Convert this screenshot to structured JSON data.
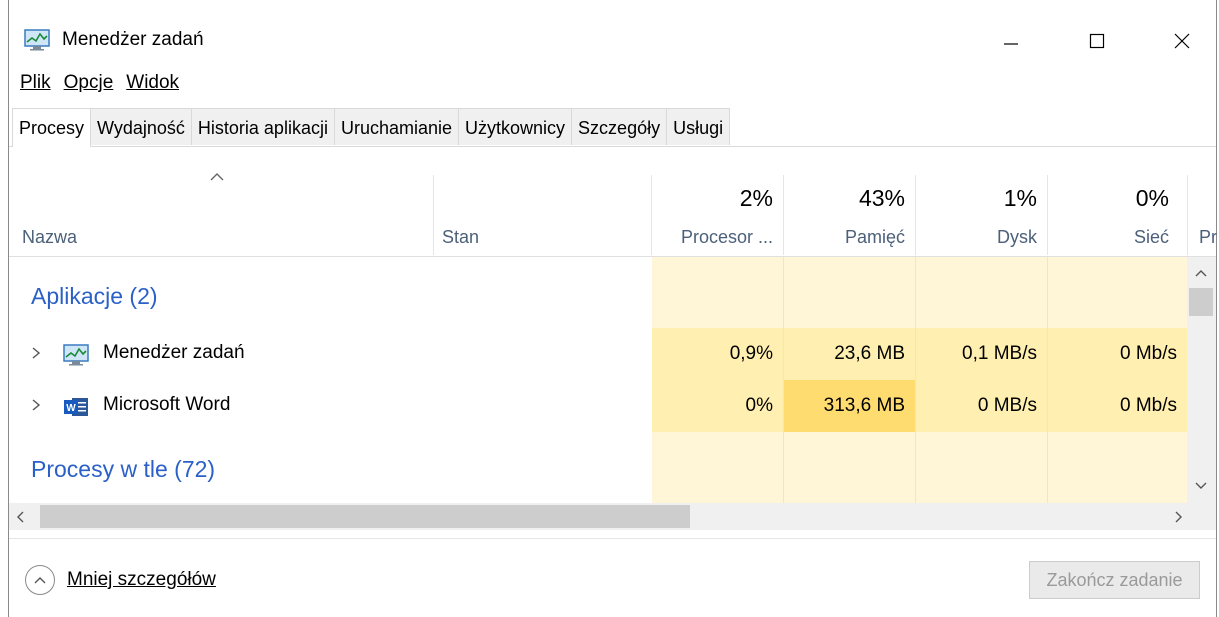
{
  "window": {
    "title": "Menedżer zadań"
  },
  "menu": [
    "Plik",
    "Opcje",
    "Widok"
  ],
  "tabs": [
    "Procesy",
    "Wydajność",
    "Historia aplikacji",
    "Uruchamianie",
    "Użytkownicy",
    "Szczegóły",
    "Usługi"
  ],
  "columns": {
    "name": "Nazwa",
    "status": "Stan",
    "cpu": {
      "pct": "2%",
      "label": "Procesor ..."
    },
    "memory": {
      "pct": "43%",
      "label": "Pamięć"
    },
    "disk": {
      "pct": "1%",
      "label": "Dysk"
    },
    "network": {
      "pct": "0%",
      "label": "Sieć"
    },
    "next": "Pr"
  },
  "groups": {
    "apps": "Aplikacje (2)",
    "background": "Procesy w tle (72)"
  },
  "rows": [
    {
      "name": "Menedżer zadań",
      "icon": "task-manager-icon",
      "cpu": "0,9%",
      "memory": "23,6 MB",
      "disk": "0,1 MB/s",
      "network": "0 Mb/s"
    },
    {
      "name": "Microsoft Word",
      "icon": "word-icon",
      "cpu": "0%",
      "memory": "313,6 MB",
      "disk": "0 MB/s",
      "network": "0 Mb/s"
    }
  ],
  "footer": {
    "less_details": "Mniej szczegółów",
    "end_task": "Zakończ zadanie"
  },
  "colors": {
    "accent_text": "#2b60c8",
    "heat_light": "#fff6d8",
    "heat_mid": "#ffefb0",
    "heat_high": "#ffdc70"
  }
}
